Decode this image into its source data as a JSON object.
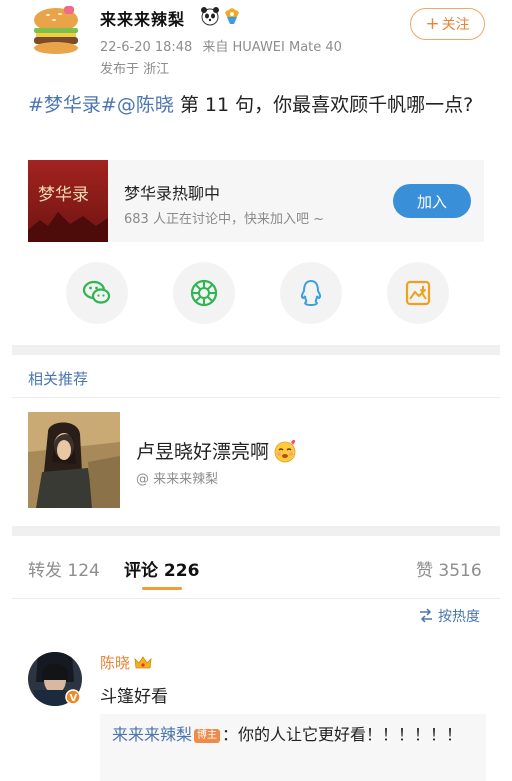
{
  "post": {
    "username": "来来来辣梨",
    "timestamp": "22-6-20 18:48",
    "source": "来自 HUAWEI Mate 40",
    "location": "发布于 浙江",
    "follow_label": "关注",
    "text_tags": "#梦华录#@陈晓",
    "text_body": " 第 11 句，你最喜欢顾千帆哪一点?"
  },
  "topic": {
    "image_text": "梦华录",
    "name": "梦华录热聊中",
    "subtitle": "683 人正在讨论中，快来加入吧 ~",
    "join_label": "加入"
  },
  "share": {
    "icons": [
      "wechat-icon",
      "moments-icon",
      "qq-icon",
      "save-image-icon"
    ]
  },
  "related": {
    "title": "相关推荐",
    "item_text": "卢昱晓好漂亮啊",
    "item_author": "@ 来来来辣梨"
  },
  "tabs": {
    "repost": "转发 124",
    "comments": "评论 226",
    "likes": "赞 3516"
  },
  "sort": {
    "label": "按热度"
  },
  "comment": {
    "name": "陈晓",
    "body": "斗篷好看",
    "reply_author": "来来来辣梨",
    "reply_tag": "博主",
    "reply_text": "：你的人让它更好看！！！！！！"
  },
  "colors": {
    "link_blue": "#4a76b0",
    "orange": "#e8833a",
    "join_blue": "#3a8fd9"
  }
}
